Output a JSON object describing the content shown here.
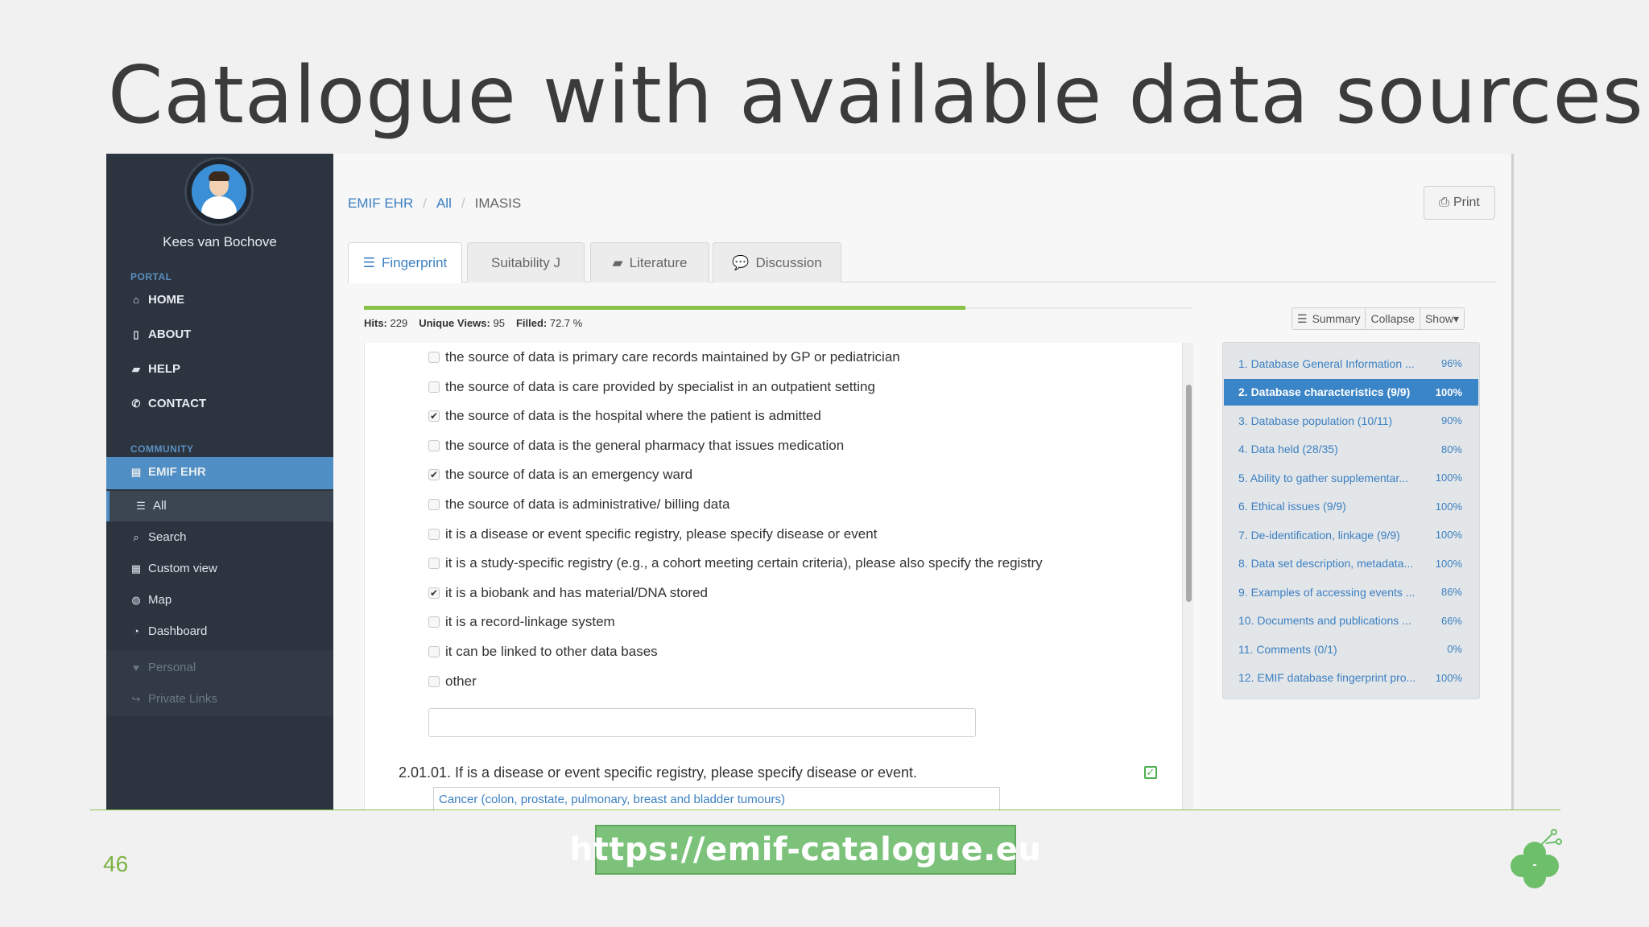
{
  "slide": {
    "title": "Catalogue with available data sources",
    "page_number": "46",
    "url": "https://emif-catalogue.eu"
  },
  "sidebar": {
    "user_name": "Kees van Bochove",
    "portal_label": "PORTAL",
    "portal_items": [
      {
        "label": "HOME",
        "icon": "home-icon"
      },
      {
        "label": "ABOUT",
        "icon": "bookmark-icon"
      },
      {
        "label": "HELP",
        "icon": "book-icon"
      },
      {
        "label": "CONTACT",
        "icon": "phone-icon"
      }
    ],
    "community_label": "COMMUNITY",
    "community_active": "EMIF EHR",
    "community_items": [
      {
        "label": "All",
        "icon": "list-icon"
      },
      {
        "label": "Search",
        "icon": "search-icon"
      },
      {
        "label": "Custom view",
        "icon": "grid-icon"
      },
      {
        "label": "Map",
        "icon": "globe-icon"
      },
      {
        "label": "Dashboard",
        "icon": "dashboard-icon"
      }
    ],
    "bottom_items": [
      {
        "label": "Personal",
        "icon": "heart-icon"
      },
      {
        "label": "Private Links",
        "icon": "share-icon"
      }
    ]
  },
  "breadcrumb": [
    "EMIF EHR",
    "All",
    "IMASIS"
  ],
  "print_label": "Print",
  "tabs": [
    {
      "label": "Fingerprint",
      "icon": "list-icon",
      "active": true
    },
    {
      "label": "Suitability J",
      "icon": "",
      "active": false
    },
    {
      "label": "Literature",
      "icon": "book-icon",
      "active": false
    },
    {
      "label": "Discussion",
      "icon": "comment-icon",
      "active": false
    }
  ],
  "stats": {
    "hits_label": "Hits:",
    "hits": "229",
    "views_label": "Unique Views:",
    "views": "95",
    "filled_label": "Filled:",
    "filled": "72.7 %",
    "filled_fraction": 0.727
  },
  "options": [
    {
      "label": "the source of data is primary care records maintained by GP or pediatrician",
      "checked": false
    },
    {
      "label": "the source of data is care provided by specialist in an outpatient setting",
      "checked": false
    },
    {
      "label": "the source of data is the hospital where the patient is admitted",
      "checked": true
    },
    {
      "label": "the source of data is the general pharmacy that issues medication",
      "checked": false
    },
    {
      "label": "the source of data is an emergency ward",
      "checked": true
    },
    {
      "label": "the source of data is administrative/ billing data",
      "checked": false
    },
    {
      "label": "it is a disease or event specific registry, please specify disease or event",
      "checked": false
    },
    {
      "label": "it is a study-specific registry (e.g., a cohort meeting certain criteria), please also specify the registry",
      "checked": false
    },
    {
      "label": "it is a biobank and has material/DNA stored",
      "checked": true
    },
    {
      "label": "it is a record-linkage system",
      "checked": false
    },
    {
      "label": "it can be linked to other data bases",
      "checked": false
    },
    {
      "label": "other",
      "checked": false
    }
  ],
  "question": {
    "label": "2.01.01. If is a disease or event specific registry, please specify disease or event.",
    "answer": "Cancer (colon, prostate, pulmonary, breast and bladder tumours)"
  },
  "controls": {
    "summary": "Summary",
    "collapse": "Collapse",
    "show": "Show▾"
  },
  "sections": [
    {
      "label": "1. Database General Information ...",
      "pct": "96%",
      "active": false
    },
    {
      "label": "2. Database characteristics (9/9)",
      "pct": "100%",
      "active": true
    },
    {
      "label": "3. Database population (10/11)",
      "pct": "90%",
      "active": false
    },
    {
      "label": "4. Data held (28/35)",
      "pct": "80%",
      "active": false
    },
    {
      "label": "5. Ability to gather supplementar...",
      "pct": "100%",
      "active": false
    },
    {
      "label": "6. Ethical issues (9/9)",
      "pct": "100%",
      "active": false
    },
    {
      "label": "7. De-identification, linkage (9/9)",
      "pct": "100%",
      "active": false
    },
    {
      "label": "8. Data set description, metadata...",
      "pct": "100%",
      "active": false
    },
    {
      "label": "9. Examples of accessing events ...",
      "pct": "86%",
      "active": false
    },
    {
      "label": "10. Documents and publications ...",
      "pct": "66%",
      "active": false
    },
    {
      "label": "11. Comments (0/1)",
      "pct": "0%",
      "active": false
    },
    {
      "label": "12. EMIF database fingerprint pro...",
      "pct": "100%",
      "active": false
    }
  ],
  "colors": {
    "accent": "#3b7fc1",
    "sidebar": "#2c3440",
    "active": "#4f8fc6",
    "progress": "#8bc34a",
    "url_box": "#7cc27a"
  }
}
